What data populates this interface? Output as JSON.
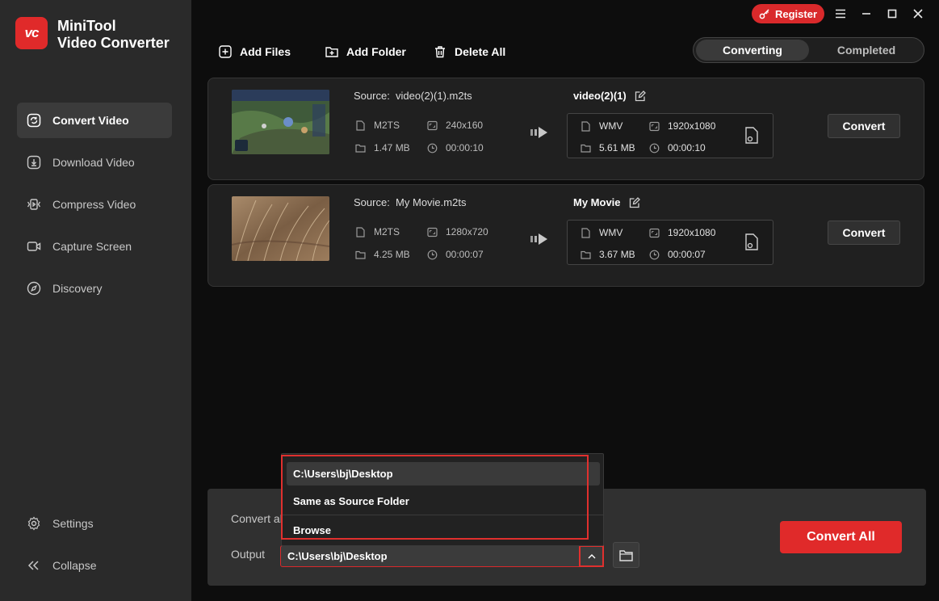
{
  "app": {
    "brand_line1": "MiniTool",
    "brand_line2": "Video Converter",
    "logo_text": "vc"
  },
  "titlebar": {
    "register_label": "Register"
  },
  "sidebar": {
    "items": [
      {
        "label": "Convert Video",
        "icon": "convert-icon",
        "active": true
      },
      {
        "label": "Download Video",
        "icon": "download-icon"
      },
      {
        "label": "Compress Video",
        "icon": "compress-icon"
      },
      {
        "label": "Capture Screen",
        "icon": "camera-icon"
      },
      {
        "label": "Discovery",
        "icon": "compass-icon"
      }
    ],
    "settings_label": "Settings",
    "collapse_label": "Collapse"
  },
  "toolbar": {
    "add_files": "Add Files",
    "add_folder": "Add Folder",
    "delete_all": "Delete All"
  },
  "tabs": {
    "converting": "Converting",
    "completed": "Completed"
  },
  "files": [
    {
      "source_label": "Source:",
      "source_name": "video(2)(1).m2ts",
      "src_format": "M2TS",
      "src_resolution": "240x160",
      "src_size": "1.47 MB",
      "src_duration": "00:00:10",
      "output_name": "video(2)(1)",
      "out_format": "WMV",
      "out_resolution": "1920x1080",
      "out_size": "5.61 MB",
      "out_duration": "00:00:10",
      "convert_label": "Convert"
    },
    {
      "source_label": "Source:",
      "source_name": "My Movie.m2ts",
      "src_format": "M2TS",
      "src_resolution": "1280x720",
      "src_size": "4.25 MB",
      "src_duration": "00:00:07",
      "output_name": "My Movie",
      "out_format": "WMV",
      "out_resolution": "1920x1080",
      "out_size": "3.67 MB",
      "out_duration": "00:00:07",
      "convert_label": "Convert"
    }
  ],
  "bottom": {
    "convert_all_to_label": "Convert al",
    "output_label": "Output",
    "output_value": "C:\\Users\\bj\\Desktop",
    "convert_all_button": "Convert All"
  },
  "dropdown": {
    "options": [
      "C:\\Users\\bj\\Desktop",
      "Same as Source Folder",
      "Browse"
    ]
  }
}
